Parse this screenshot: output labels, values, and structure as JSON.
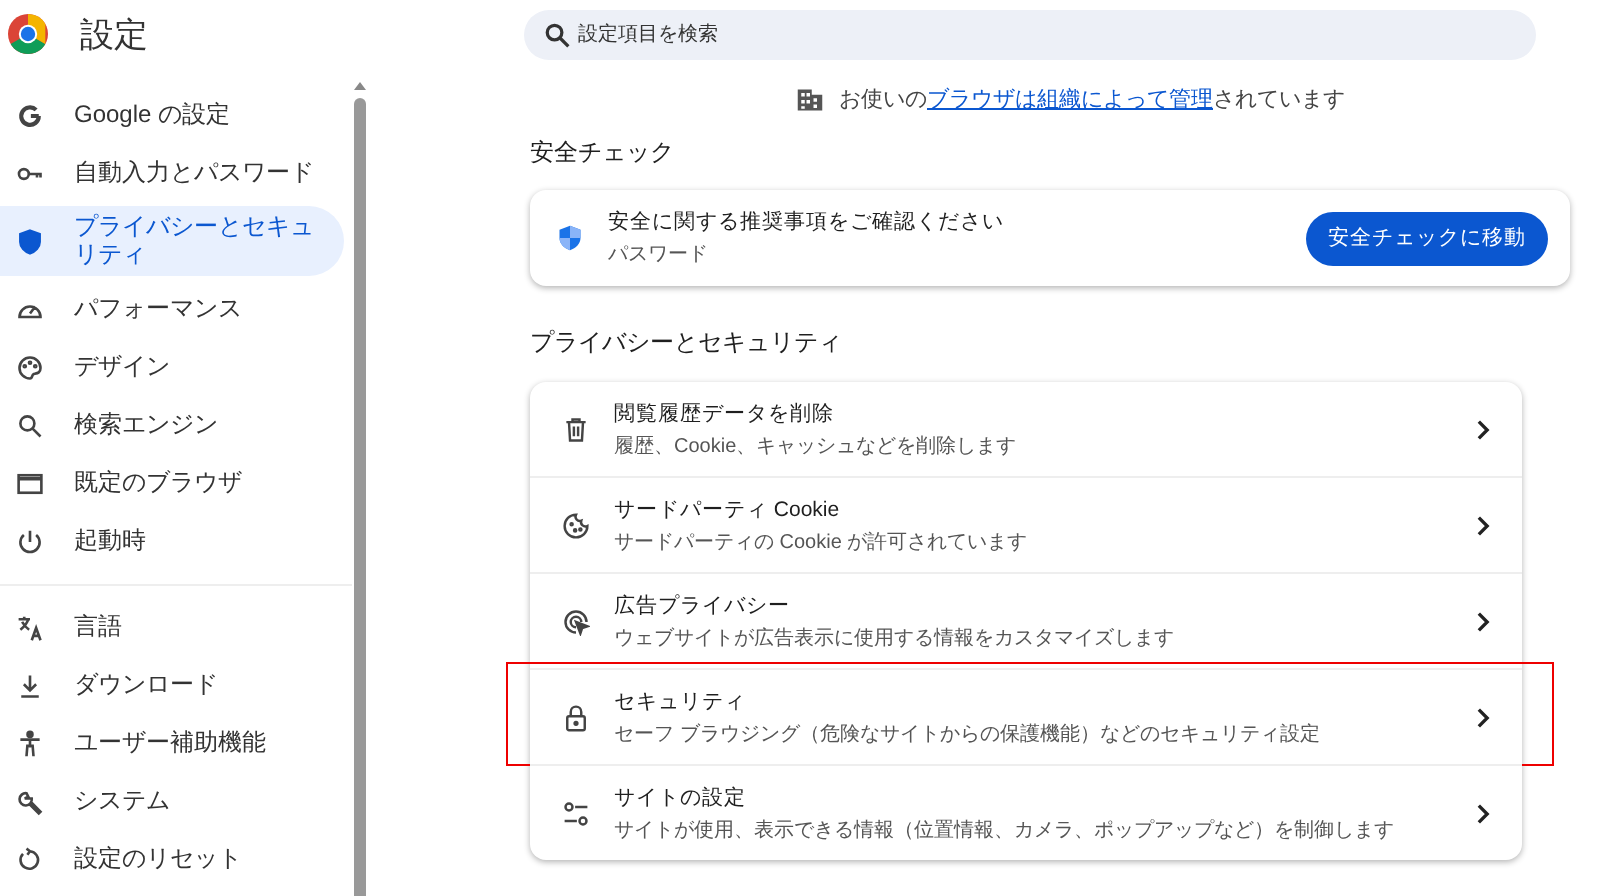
{
  "header": {
    "title": "設定"
  },
  "sidebar": {
    "groups": [
      [
        {
          "label": "Google の設定",
          "selected": false
        },
        {
          "label": "自動入力とパスワード",
          "selected": false
        },
        {
          "label": "プライバシーとセキュリティ",
          "selected": true
        },
        {
          "label": "パフォーマンス",
          "selected": false
        },
        {
          "label": "デザイン",
          "selected": false
        },
        {
          "label": "検索エンジン",
          "selected": false
        },
        {
          "label": "既定のブラウザ",
          "selected": false
        },
        {
          "label": "起動時",
          "selected": false
        }
      ],
      [
        {
          "label": "言語",
          "selected": false
        },
        {
          "label": "ダウンロード",
          "selected": false
        },
        {
          "label": "ユーザー補助機能",
          "selected": false
        },
        {
          "label": "システム",
          "selected": false
        },
        {
          "label": "設定のリセット",
          "selected": false
        }
      ]
    ]
  },
  "search": {
    "placeholder": "設定項目を検索"
  },
  "managed_notice": {
    "before": "お使いの",
    "link": "ブラウザは組織によって管理",
    "after": "されています"
  },
  "safety_check": {
    "heading": "安全チェック",
    "title": "安全に関する推奨事項をご確認ください",
    "subtitle": "パスワード",
    "button": "安全チェックに移動"
  },
  "privacy": {
    "heading": "プライバシーとセキュリティ",
    "rows": [
      {
        "title": "閲覧履歴データを削除",
        "subtitle": "履歴、Cookie、キャッシュなどを削除します",
        "highlighted": false
      },
      {
        "title": "サードパーティ Cookie",
        "subtitle": "サードパーティの Cookie が許可されています",
        "highlighted": false
      },
      {
        "title": "広告プライバシー",
        "subtitle": "ウェブサイトが広告表示に使用する情報をカスタマイズします",
        "highlighted": false
      },
      {
        "title": "セキュリティ",
        "subtitle": "セーフ ブラウジング（危険なサイトからの保護機能）などのセキュリティ設定",
        "highlighted": true
      },
      {
        "title": "サイトの設定",
        "subtitle": "サイトが使用、表示できる情報（位置情報、カメラ、ポップアップなど）を制御します",
        "highlighted": false
      }
    ]
  }
}
